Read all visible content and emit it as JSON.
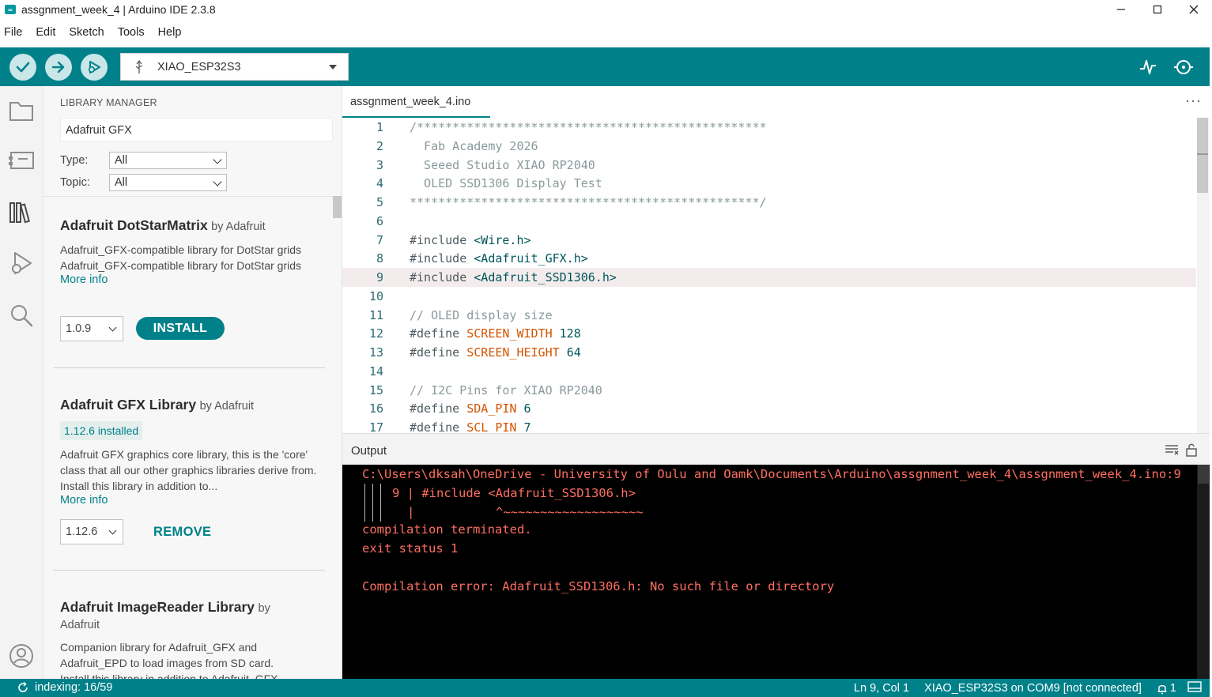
{
  "window": {
    "title": "assgnment_week_4 | Arduino IDE 2.3.8",
    "controls": {
      "minimize": "—",
      "maximize": "☐",
      "close": "✕"
    }
  },
  "menu": [
    "File",
    "Edit",
    "Sketch",
    "Tools",
    "Help"
  ],
  "toolbar": {
    "board": "XIAO_ESP32S3",
    "buttons": {
      "verify": "check-icon",
      "upload": "arrow-right-icon",
      "debug": "debug-icon"
    },
    "right_icons": {
      "serial_plotter": "plotter-icon",
      "serial_monitor": "monitor-icon"
    },
    "accent": "#00818a"
  },
  "library_manager": {
    "heading": "LIBRARY MANAGER",
    "search_value": "Adafruit GFX",
    "type_label": "Type:",
    "type_value": "All",
    "topic_label": "Topic:",
    "topic_value": "All",
    "items": [
      {
        "name": "Adafruit DotStarMatrix",
        "by": "by Adafruit",
        "description": "Adafruit_GFX-compatible library for DotStar grids Adafruit_GFX-compatible library for DotStar grids",
        "more_info": "More info",
        "version": "1.0.9",
        "action": "INSTALL"
      },
      {
        "name": "Adafruit GFX Library",
        "by": "by Adafruit",
        "installed": "1.12.6 installed",
        "description": "Adafruit GFX graphics core library, this is the 'core' class that all our other graphics libraries derive from. Install this library in addition to...",
        "more_info": "More info",
        "version": "1.12.6",
        "action": "REMOVE"
      },
      {
        "name": "Adafruit ImageReader Library",
        "by": "by",
        "by2": "Adafruit",
        "description": "Companion library for Adafruit_GFX and Adafruit_EPD to load images from SD card.",
        "description_cut": "Install this library in addition to Adafruit_GFX..."
      }
    ]
  },
  "editor": {
    "tab": "assgnment_week_4.ino",
    "tab_menu": "···",
    "current_line": 9,
    "lines": [
      "/*************************************************",
      "  Fab Academy 2026",
      "  Seeed Studio XIAO RP2040",
      "  OLED SSD1306 Display Test",
      "*************************************************/",
      "",
      "#include <Wire.h>",
      "#include <Adafruit_GFX.h>",
      "#include <Adafruit_SSD1306.h>",
      "",
      "// OLED display size",
      "#define SCREEN_WIDTH 128",
      "#define SCREEN_HEIGHT 64",
      "",
      "// I2C Pins for XIAO RP2040",
      "#define SDA_PIN 6",
      "#define SCL_PIN 7"
    ]
  },
  "output": {
    "title": "Output",
    "lines": [
      "C:\\Users\\dksah\\OneDrive - University of Oulu and Oamk\\Documents\\Arduino\\assgnment_week_4\\assgnment_week_4.ino:9",
      "9 | #include <Adafruit_SSD1306.h>",
      "|           ^~~~~~~~~~~~~~~~~~~~",
      "compilation terminated.",
      "exit status 1",
      "",
      "Compilation error: Adafruit_SSD1306.h: No such file or directory"
    ],
    "color": "#ff6f61"
  },
  "status": {
    "indexing": "indexing: 16/59",
    "position": "Ln 9, Col 1",
    "board_port": "XIAO_ESP32S3 on COM9 [not connected]",
    "notifications": "1"
  }
}
